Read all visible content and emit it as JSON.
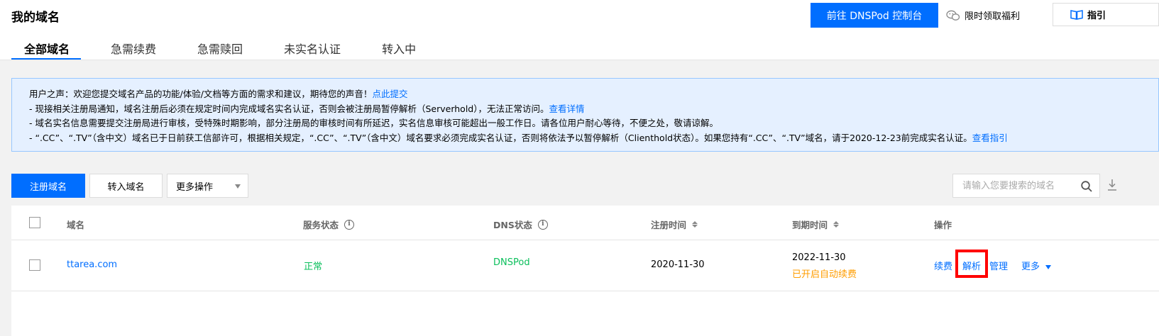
{
  "header": {
    "title": "我的域名",
    "dnspod_button": "前往 DNSPod 控制台",
    "welfare_label": "限时领取福利",
    "guide_label": "指引"
  },
  "tabs": [
    {
      "label": "全部域名",
      "active": true
    },
    {
      "label": "急需续费",
      "active": false
    },
    {
      "label": "急需赎回",
      "active": false
    },
    {
      "label": "未实名认证",
      "active": false
    },
    {
      "label": "转入中",
      "active": false
    }
  ],
  "notice": {
    "line1_text": "用户之声：欢迎您提交域名产品的功能/体验/文档等方面的需求和建议，期待您的声音！",
    "line1_link": "点此提交",
    "line2_text": "- 现接相关注册局通知，域名注册后必须在规定时间内完成域名实名认证，否则会被注册局暂停解析（Serverhold），无法正常访问。",
    "line2_link": "查看详情",
    "line3_text": "- 域名实名信息需要提交注册局进行审核，受特殊时期影响，部分注册局的审核时间有所延迟，实名信息审核可能超出一般工作日。请各位用户耐心等待，不便之处，敬请谅解。",
    "line4_text": "- “.CC”、“.TV”（含中文）域名已于日前获工信部许可，根据相关规定，“.CC”、“.TV”（含中文）域名要求必须完成实名认证，否则将依法予以暂停解析（Clienthold状态）。如果您持有“.CC”、“.TV”域名，请于2020-12-23前完成实名认证。",
    "line4_link": "查看指引"
  },
  "toolbar": {
    "register_label": "注册域名",
    "transfer_label": "转入域名",
    "more_label": "更多操作",
    "search_placeholder": "请输入您要搜索的域名"
  },
  "table": {
    "headers": {
      "domain": "域名",
      "service_status": "服务状态",
      "dns_status": "DNS状态",
      "register_time": "注册时间",
      "expire_time": "到期时间",
      "actions": "操作"
    },
    "rows": [
      {
        "domain": "ttarea.com",
        "service_status": "正常",
        "dns_status": "DNSPod",
        "register_time": "2020-11-30",
        "expire_time": "2022-11-30",
        "auto_renew": "已开启自动续费",
        "actions": {
          "renew": "续费",
          "resolve": "解析",
          "manage": "管理",
          "more": "更多"
        }
      }
    ]
  },
  "colors": {
    "primary": "#006eff",
    "success": "#0abf5b",
    "warning": "#ff9d00",
    "highlight_box": "#ff0000"
  }
}
